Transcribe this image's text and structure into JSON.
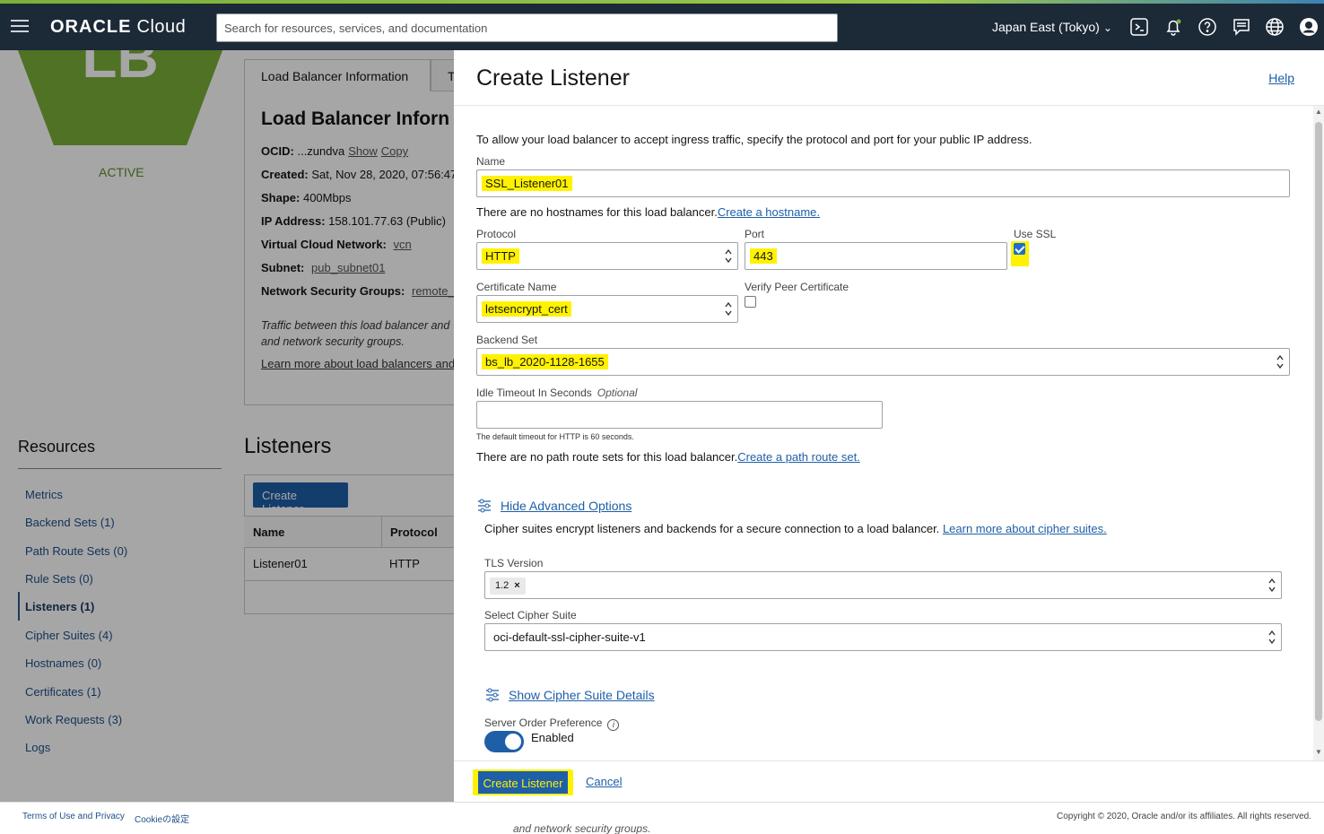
{
  "topbar": {
    "logo_bold": "ORACLE",
    "logo_light": "Cloud",
    "search_placeholder": "Search for resources, services, and documentation",
    "region": "Japan East (Tokyo)"
  },
  "background": {
    "lb_badge": "LB",
    "status": "ACTIVE",
    "info_tab": "Load Balancer Information",
    "info_tab2": "T",
    "info_title": "Load Balancer Inforn",
    "ocid_label": "OCID:",
    "ocid_value": "...zundva",
    "ocid_show": "Show",
    "ocid_copy": "Copy",
    "created_label": "Created:",
    "created_value": "Sat, Nov 28, 2020, 07:56:47",
    "shape_label": "Shape:",
    "shape_value": "400Mbps",
    "ip_label": "IP Address:",
    "ip_value": "158.101.77.63 (Public)",
    "vcn_label": "Virtual Cloud Network:",
    "vcn_value": "vcn",
    "subnet_label": "Subnet:",
    "subnet_value": "pub_subnet01",
    "nsg_label": "Network Security Groups:",
    "nsg_value": "remote_a",
    "note_line1": "Traffic between this load balancer and",
    "note_line2": "and network security groups.",
    "learn_more": "Learn more about load balancers and",
    "resources_title": "Resources",
    "resources": [
      "Metrics",
      "Backend Sets (1)",
      "Path Route Sets (0)",
      "Rule Sets (0)",
      "Listeners (1)",
      "Cipher Suites (4)",
      "Hostnames (0)",
      "Certificates (1)",
      "Work Requests (3)",
      "Logs"
    ],
    "listeners_title": "Listeners",
    "create_listener_btn": "Create Listener",
    "table_headers": [
      "Name",
      "Protocol"
    ],
    "table_row": [
      "Listener01",
      "HTTP"
    ]
  },
  "panel": {
    "title": "Create Listener",
    "help": "Help",
    "intro": "To allow your load balancer to accept ingress traffic, specify the protocol and port for your public IP address.",
    "name_label": "Name",
    "name_value": "SSL_Listener01",
    "hostname_note": "There are no hostnames for this load balancer.",
    "hostname_link": "Create a hostname.",
    "protocol_label": "Protocol",
    "protocol_value": "HTTP",
    "port_label": "Port",
    "port_value": "443",
    "use_ssl_label": "Use SSL",
    "use_ssl_checked": true,
    "cert_label": "Certificate Name",
    "cert_value": "letsencrypt_cert",
    "verify_label": "Verify Peer Certificate",
    "verify_checked": false,
    "backend_label": "Backend Set",
    "backend_value": "bs_lb_2020-1128-1655",
    "idle_label": "Idle Timeout In Seconds",
    "idle_optional": "Optional",
    "idle_value": "",
    "idle_help": "The default timeout for HTTP is 60 seconds.",
    "path_note": "There are no path route sets for this load balancer.",
    "path_link": "Create a path route set.",
    "advanced_toggle": "Hide Advanced Options",
    "cipher_note": "Cipher suites encrypt listeners and backends for a secure connection to a load balancer.",
    "cipher_link": "Learn more about cipher suites.",
    "tls_label": "TLS Version",
    "tls_chip": "1.2",
    "cipher_label": "Select Cipher Suite",
    "cipher_value": "oci-default-ssl-cipher-suite-v1",
    "cipher_details": "Show Cipher Suite Details",
    "server_order_label": "Server Order Preference",
    "server_order_value": "Enabled",
    "create_btn": "Create Listener",
    "cancel_btn": "Cancel"
  },
  "footer": {
    "terms": "Terms of Use and Privacy",
    "cookie": "Cookieの設定",
    "copyright": "Copyright © 2020, Oracle and/or its affiliates. All rights reserved.",
    "ghost_text": "and network security groups."
  },
  "colors": {
    "topbar": "#1c2937",
    "accent_green": "#7ab03a",
    "primary_blue": "#1e5fa8",
    "highlight": "#fff200"
  }
}
